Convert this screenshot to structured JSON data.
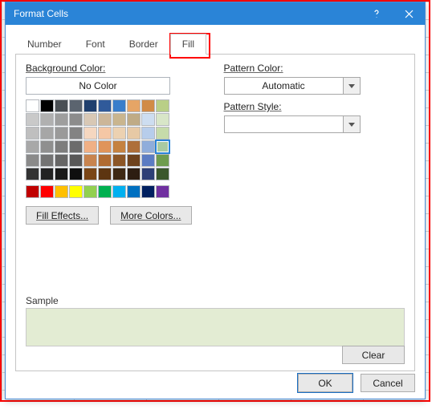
{
  "window": {
    "title": "Format Cells"
  },
  "tabs": {
    "items": [
      "Number",
      "Font",
      "Border",
      "Fill"
    ],
    "activeIndex": 3
  },
  "fill": {
    "bg_label": "Background Color:",
    "no_color": "No Color",
    "fill_effects": "Fill Effects...",
    "more_colors": "More Colors...",
    "pattern_color_label": "Pattern Color:",
    "pattern_color_value": "Automatic",
    "pattern_style_label": "Pattern Style:",
    "pattern_style_value": ""
  },
  "sample": {
    "label": "Sample",
    "color": "#e3ecd3"
  },
  "buttons": {
    "clear": "Clear",
    "ok": "OK",
    "cancel": "Cancel"
  },
  "palette": {
    "selectedIndex": 39,
    "main": [
      "nocolor",
      "#000000",
      "#4a4f54",
      "#5b646f",
      "#1f3f6e",
      "#305a9a",
      "#3a7ecb",
      "#e6a566",
      "#d18b47",
      "#b9cf87",
      "#c9c9c9",
      "#b0b0b0",
      "#9e9e9e",
      "#8c8c8c",
      "#d8c8b5",
      "#ccb699",
      "#c9b58e",
      "#bfab86",
      "#cdddf0",
      "#d8e6c8",
      "#bfbfbf",
      "#a6a6a6",
      "#9a9a9a",
      "#838383",
      "#f5d7c0",
      "#f5c7a5",
      "#ecd1b1",
      "#e7c9a5",
      "#b7cdeb",
      "#c6dbaa",
      "#a8a8a8",
      "#8f8f8f",
      "#7d7d7d",
      "#6c6c6c",
      "#f0b085",
      "#e0945a",
      "#c58240",
      "#ae6f3a",
      "#8faddb",
      "#a8caa2",
      "#8a8a8a",
      "#737373",
      "#666666",
      "#585858",
      "#c8844f",
      "#b06b32",
      "#8c5626",
      "#6e421d",
      "#5b7cc3",
      "#6e9c4e",
      "#333333",
      "#222222",
      "#191919",
      "#0f0f0f",
      "#7a4617",
      "#5d3511",
      "#3e2914",
      "#2d1d11",
      "#2d3f77",
      "#3a572c"
    ],
    "standard": [
      "#c00000",
      "#ff0000",
      "#ffc000",
      "#ffff00",
      "#92d050",
      "#00b050",
      "#00b0f0",
      "#0070c0",
      "#002060",
      "#7030a0"
    ]
  }
}
